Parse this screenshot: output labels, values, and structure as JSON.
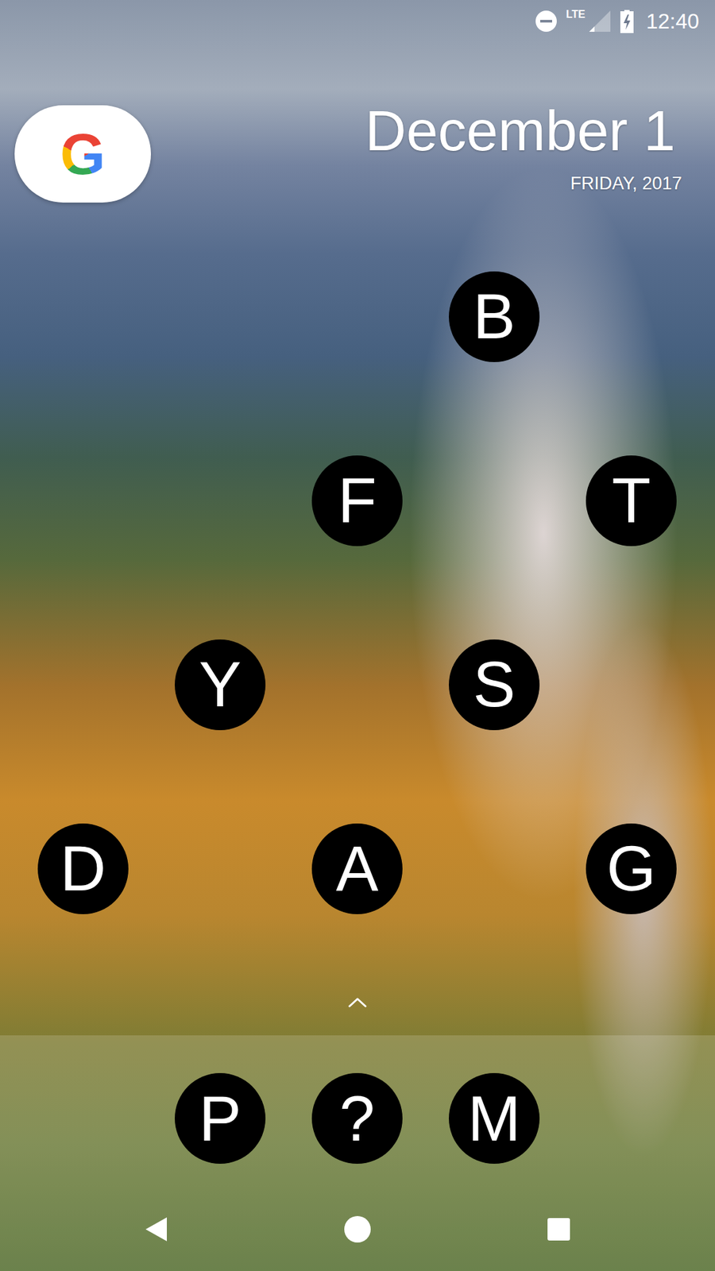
{
  "status_bar": {
    "do_not_disturb": true,
    "network": "LTE",
    "signal_level": 0.25,
    "battery": {
      "level": 1,
      "charging": true
    },
    "time": "12:40"
  },
  "search_widget": {
    "logo": "G"
  },
  "date_widget": {
    "date": "December 1",
    "weekday_year": "FRIDAY, 2017"
  },
  "home_grid": {
    "rows": [
      [
        null,
        null,
        null,
        "B",
        null
      ],
      [
        null,
        null,
        "F",
        null,
        "T"
      ],
      [
        null,
        "Y",
        null,
        "S",
        null
      ],
      [
        "D",
        null,
        "A",
        null,
        "G"
      ]
    ]
  },
  "dock": {
    "items": [
      null,
      "P",
      "?",
      "M",
      null
    ]
  }
}
